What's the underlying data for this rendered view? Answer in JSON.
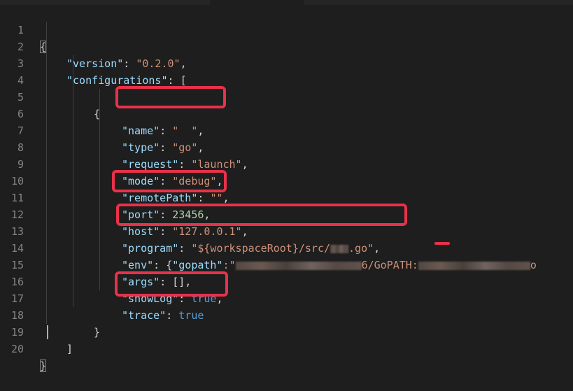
{
  "editor": {
    "lines": [
      {
        "n": "1"
      },
      {
        "n": "2",
        "k": "\"version\"",
        "sep": ": ",
        "v": "\"0.2.0\"",
        "end": ","
      },
      {
        "n": "3",
        "k": "\"configurations\"",
        "sep": ": ",
        "end": "["
      },
      {
        "n": "4"
      },
      {
        "n": "5",
        "end": "{"
      },
      {
        "n": "6",
        "k": "\"name\"",
        "sep": ": ",
        "v": "\"  \"",
        "end": ","
      },
      {
        "n": "7",
        "k": "\"type\"",
        "sep": ": ",
        "v": "\"go\"",
        "end": ","
      },
      {
        "n": "8",
        "k": "\"request\"",
        "sep": ": ",
        "v": "\"launch\"",
        "end": ","
      },
      {
        "n": "9",
        "k": "\"mode\"",
        "sep": ": ",
        "v": "\"debug\"",
        "end": ","
      },
      {
        "n": "10",
        "k": "\"remotePath\"",
        "sep": ": ",
        "v": "\"\"",
        "end": ","
      },
      {
        "n": "11",
        "k": "\"port\"",
        "sep": ": ",
        "v": "23456",
        "end": ","
      },
      {
        "n": "12",
        "k": "\"host\"",
        "sep": ": ",
        "v": "\"127.0.0.1\"",
        "end": ","
      },
      {
        "n": "13",
        "k": "\"program\"",
        "sep": ": ",
        "v": "\"${workspaceRoot}/src/",
        "v2": ".go\"",
        "end": ","
      },
      {
        "n": "14",
        "k": "\"env\"",
        "sep": ": {",
        "k2": "\"gopath\"",
        "sep2": ":\"",
        "v": "6/GoPATH:",
        "v3": "o"
      },
      {
        "n": "15",
        "k": "\"args\"",
        "sep": ": ",
        "end": "[],"
      },
      {
        "n": "16",
        "k": "\"showLog\"",
        "sep": ": ",
        "v": "true",
        "end": ","
      },
      {
        "n": "17",
        "k": "\"trace\"",
        "sep": ": ",
        "v": "true"
      },
      {
        "n": "18",
        "end": "}"
      },
      {
        "n": "19",
        "end": "]"
      },
      {
        "n": "20",
        "end": "}"
      }
    ],
    "line1_text": "{",
    "line20_text": "}"
  },
  "colors": {
    "background": "#1e1e1e",
    "key": "#9cdcfe",
    "string": "#ce9178",
    "number": "#b5cea8",
    "boolean": "#569cd6",
    "highlight": "#e8314a"
  }
}
